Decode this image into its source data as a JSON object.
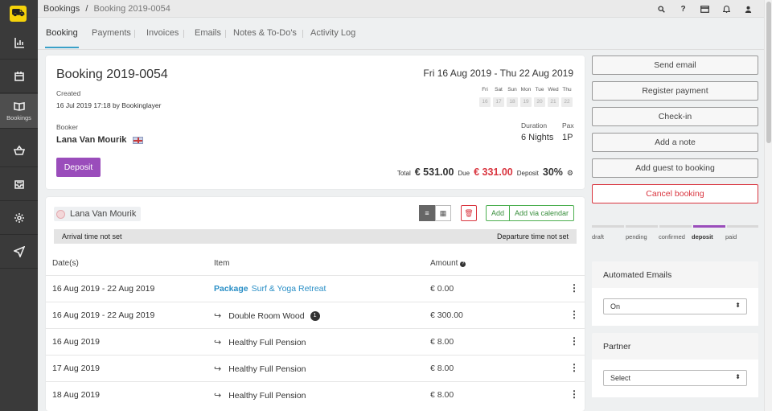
{
  "sidebar": {
    "logo_text": "⛟",
    "items": [
      {
        "name": "reports",
        "label": ""
      },
      {
        "name": "calendar",
        "label": ""
      },
      {
        "name": "bookings",
        "label": "Bookings"
      },
      {
        "name": "shop",
        "label": ""
      },
      {
        "name": "inbox",
        "label": ""
      },
      {
        "name": "settings",
        "label": ""
      },
      {
        "name": "send",
        "label": ""
      }
    ]
  },
  "topbar": {
    "breadcrumb_root": "Bookings",
    "breadcrumb_sep": "/",
    "breadcrumb_current": "Booking 2019-0054"
  },
  "tabs": [
    "Booking",
    "Payments",
    "Invoices",
    "Emails",
    "Notes & To-Do's",
    "Activity Log"
  ],
  "booking": {
    "title": "Booking 2019-0054",
    "created_label": "Created",
    "created_value": "16 Jul 2019 17:18 by Bookinglayer",
    "date_range": "Fri 16 Aug 2019 - Thu 22 Aug 2019",
    "days": [
      {
        "dow": "Fri",
        "num": "16"
      },
      {
        "dow": "Sat",
        "num": "17"
      },
      {
        "dow": "Sun",
        "num": "18"
      },
      {
        "dow": "Mon",
        "num": "19"
      },
      {
        "dow": "Tue",
        "num": "20"
      },
      {
        "dow": "Wed",
        "num": "21"
      },
      {
        "dow": "Thu",
        "num": "22"
      }
    ],
    "booker_label": "Booker",
    "booker_name": "Lana Van Mourik",
    "duration_label": "Duration",
    "duration_value": "6 Nights",
    "pax_label": "Pax",
    "pax_value": "1P",
    "deposit_button": "Deposit",
    "total_label": "Total",
    "total_value": "€ 531.00",
    "due_label": "Due",
    "due_value": "€ 331.00",
    "deposit_label": "Deposit",
    "deposit_value": "30%"
  },
  "items": {
    "guest_name": "Lana Van Mourik",
    "add_label": "Add",
    "add_calendar_label": "Add via calendar",
    "arrival_text": "Arrival time not set",
    "departure_text": "Departure time not set",
    "headers": {
      "dates": "Date(s)",
      "item": "Item",
      "amount": "Amount"
    },
    "rows": [
      {
        "date": "16 Aug 2019 - 22 Aug 2019",
        "prefix": "Package",
        "item": "Surf & Yoga Retreat",
        "amount": "€ 0.00"
      },
      {
        "date": "16 Aug 2019 - 22 Aug 2019",
        "prefix": "↪",
        "item": "Double Room Wood",
        "badge": "1",
        "amount": "€ 300.00"
      },
      {
        "date": "16 Aug 2019",
        "prefix": "↪",
        "item": "Healthy Full Pension",
        "amount": "€ 8.00"
      },
      {
        "date": "17 Aug 2019",
        "prefix": "↪",
        "item": "Healthy Full Pension",
        "amount": "€ 8.00"
      },
      {
        "date": "18 Aug 2019",
        "prefix": "↪",
        "item": "Healthy Full Pension",
        "amount": "€ 8.00"
      }
    ]
  },
  "actions": [
    "Send email",
    "Register payment",
    "Check-in",
    "Add a note",
    "Add guest to booking",
    "Cancel booking"
  ],
  "status": {
    "steps": [
      "draft",
      "pending",
      "confirmed",
      "deposit",
      "paid"
    ],
    "current": "deposit",
    "accent": "#9a4dbb"
  },
  "automated_emails": {
    "title": "Automated Emails",
    "value": "On"
  },
  "partner": {
    "title": "Partner",
    "value": "Select"
  },
  "colors": {
    "accent_blue": "#2a8fc6",
    "danger": "#d9353f",
    "purple": "#9a4dbb",
    "sidebar": "#3a3a3a"
  }
}
